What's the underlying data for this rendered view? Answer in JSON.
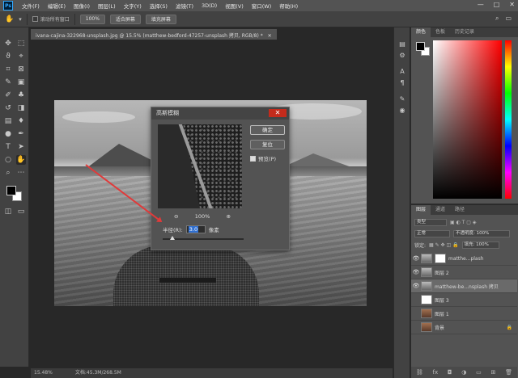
{
  "menubar": {
    "logo": "Ps",
    "items": [
      "文件(F)",
      "编辑(E)",
      "图像(I)",
      "图层(L)",
      "文字(Y)",
      "选择(S)",
      "滤镜(T)",
      "3D(D)",
      "视图(V)",
      "窗口(W)",
      "帮助(H)"
    ],
    "controls": [
      "—",
      "□",
      "✕"
    ]
  },
  "options": {
    "scroll_all_label": "滚动所有窗口",
    "zoom_100_label": "100%",
    "fit_screen_label": "适合屏幕",
    "fill_screen_label": "填充屏幕"
  },
  "document": {
    "tab_title": "ivana-cajina-322968-unsplash.jpg @ 15.5% (matthew-bedford-47257-unsplash 拷贝, RGB/8) *",
    "tab_close": "✕"
  },
  "dialog": {
    "title": "高斯模糊",
    "close": "✕",
    "ok_label": "确定",
    "reset_label": "复位",
    "preview_label": "预览(P)",
    "zoom_out": "⊖",
    "zoom_level": "100%",
    "zoom_in": "⊕",
    "radius_label": "半径(R):",
    "radius_value": "3.0",
    "radius_unit": "像素",
    "radius_slider_fraction": 0.12
  },
  "status": {
    "zoom": "15.48%",
    "doc_info": "文档:45.3M/268.5M"
  },
  "color_panel": {
    "tabs": [
      "颜色",
      "色板",
      "历史记录"
    ]
  },
  "layers_panel": {
    "tabs": [
      "图层",
      "通道",
      "路径"
    ],
    "filter_label": "类型",
    "blend_mode": "正常",
    "opacity_label": "不透明度: 100%",
    "lock_label": "锁定:",
    "fill_label": "填充: 100%",
    "layers": [
      {
        "name": "matthe...plash",
        "thumb": "photo",
        "selected": false
      },
      {
        "name": "图层 2",
        "thumb": "photo",
        "selected": false
      },
      {
        "name": "matthew-be...nsplash 拷贝",
        "thumb": "photo",
        "selected": true
      },
      {
        "name": "图层 3",
        "thumb": "white",
        "selected": false
      },
      {
        "name": "图层 1",
        "thumb": "bg",
        "selected": false
      },
      {
        "name": "背景",
        "thumb": "bg",
        "selected": false
      }
    ],
    "footer_icons": [
      "link-icon",
      "fx-icon",
      "mask-icon",
      "adjustment-icon",
      "folder-icon",
      "new-layer-icon",
      "trash-icon"
    ]
  },
  "colors": {
    "accent_red_arrow": "#e03a3a",
    "selection_blue": "#2f6fd1",
    "close_red": "#c42b1c"
  }
}
